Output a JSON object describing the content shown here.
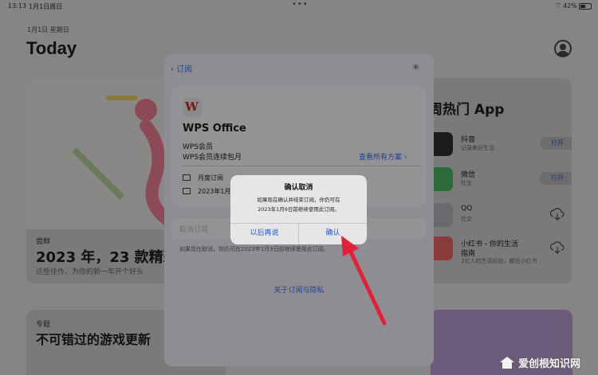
{
  "status_bar": {
    "time": "13:13",
    "date": "1月1日周日",
    "battery": "42%"
  },
  "today": {
    "date_label": "1月1日 星期日",
    "title": "Today",
    "cards": {
      "feature": {
        "tag": "尝鲜",
        "title": "2023 年，23 款精彩",
        "subtitle": "这些佳作，为你的新一年开个好头"
      },
      "topic": {
        "tag": "专题",
        "title": "不可错过的游戏更新"
      }
    },
    "hot_apps": {
      "heading": "周热门 App",
      "apps": [
        {
          "name": "抖音",
          "desc": "记录美好生活",
          "action": "打开"
        },
        {
          "name": "微信",
          "desc": "社交",
          "action": "打开"
        },
        {
          "name": "QQ",
          "desc": "社交",
          "action": ""
        },
        {
          "name": "小红书 - 你的生活",
          "name2": "指南",
          "desc": "2亿人的生活经验，都在小红书",
          "action": ""
        }
      ]
    }
  },
  "sheet": {
    "back_label": "订阅",
    "app_name": "WPS Office",
    "plan_group": "WPS会员",
    "plan_name": "WPS会员连续包月",
    "view_all": "查看所有方案 ›",
    "rows": [
      "月度订阅",
      "2023年1月"
    ],
    "cancel_label": "取消订阅",
    "cancel_note": "如果现在取消，你仍可在2023年1月9日前继续使用此订阅。",
    "privacy_link": "关于订阅与隐私"
  },
  "alert": {
    "title": "确认取消",
    "message_lines": [
      "如果现在确认并结束订阅，你仍可在",
      "2023年1月9日前继续使用此订阅。"
    ],
    "later_button": "以后再说",
    "confirm_button": "确认"
  },
  "watermark": {
    "text": "爱创根知识网"
  },
  "colors": {
    "link": "#1d5ad6",
    "arrow": "#e0213a",
    "wps": "#c0392b"
  }
}
